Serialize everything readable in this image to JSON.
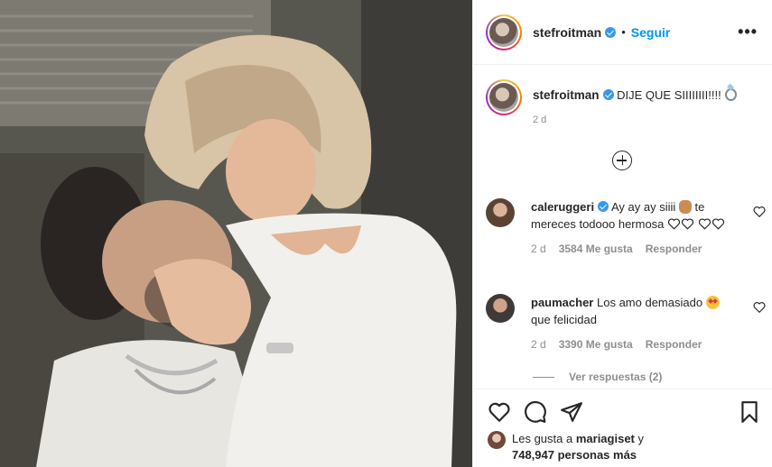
{
  "post": {
    "author": "stefroitman",
    "follow_label": "Seguir",
    "separator": "•",
    "more_label": "•••",
    "caption": "DIJE QUE SIIIIIIII!!!!",
    "caption_time": "2 d"
  },
  "comments": [
    {
      "user": "caleruggeri",
      "text_a": "Ay ay ay siiii",
      "text_b": "te mereces todooo hermosa",
      "time": "2 d",
      "likes": "3584 Me gusta",
      "reply_label": "Responder"
    },
    {
      "user": "paumacher",
      "text_a": "Los amo demasiado",
      "text_b": "que felicidad",
      "time": "2 d",
      "likes": "3390 Me gusta",
      "reply_label": "Responder"
    }
  ],
  "view_replies": "Ver respuestas (2)",
  "likes": {
    "prefix": "Les gusta a",
    "user": "mariagiset",
    "and": "y",
    "count": "748,947 personas más"
  },
  "colors": {
    "accent": "#0095f6",
    "muted": "#8e8e8e",
    "text": "#262626",
    "verified": "#3897f0"
  }
}
